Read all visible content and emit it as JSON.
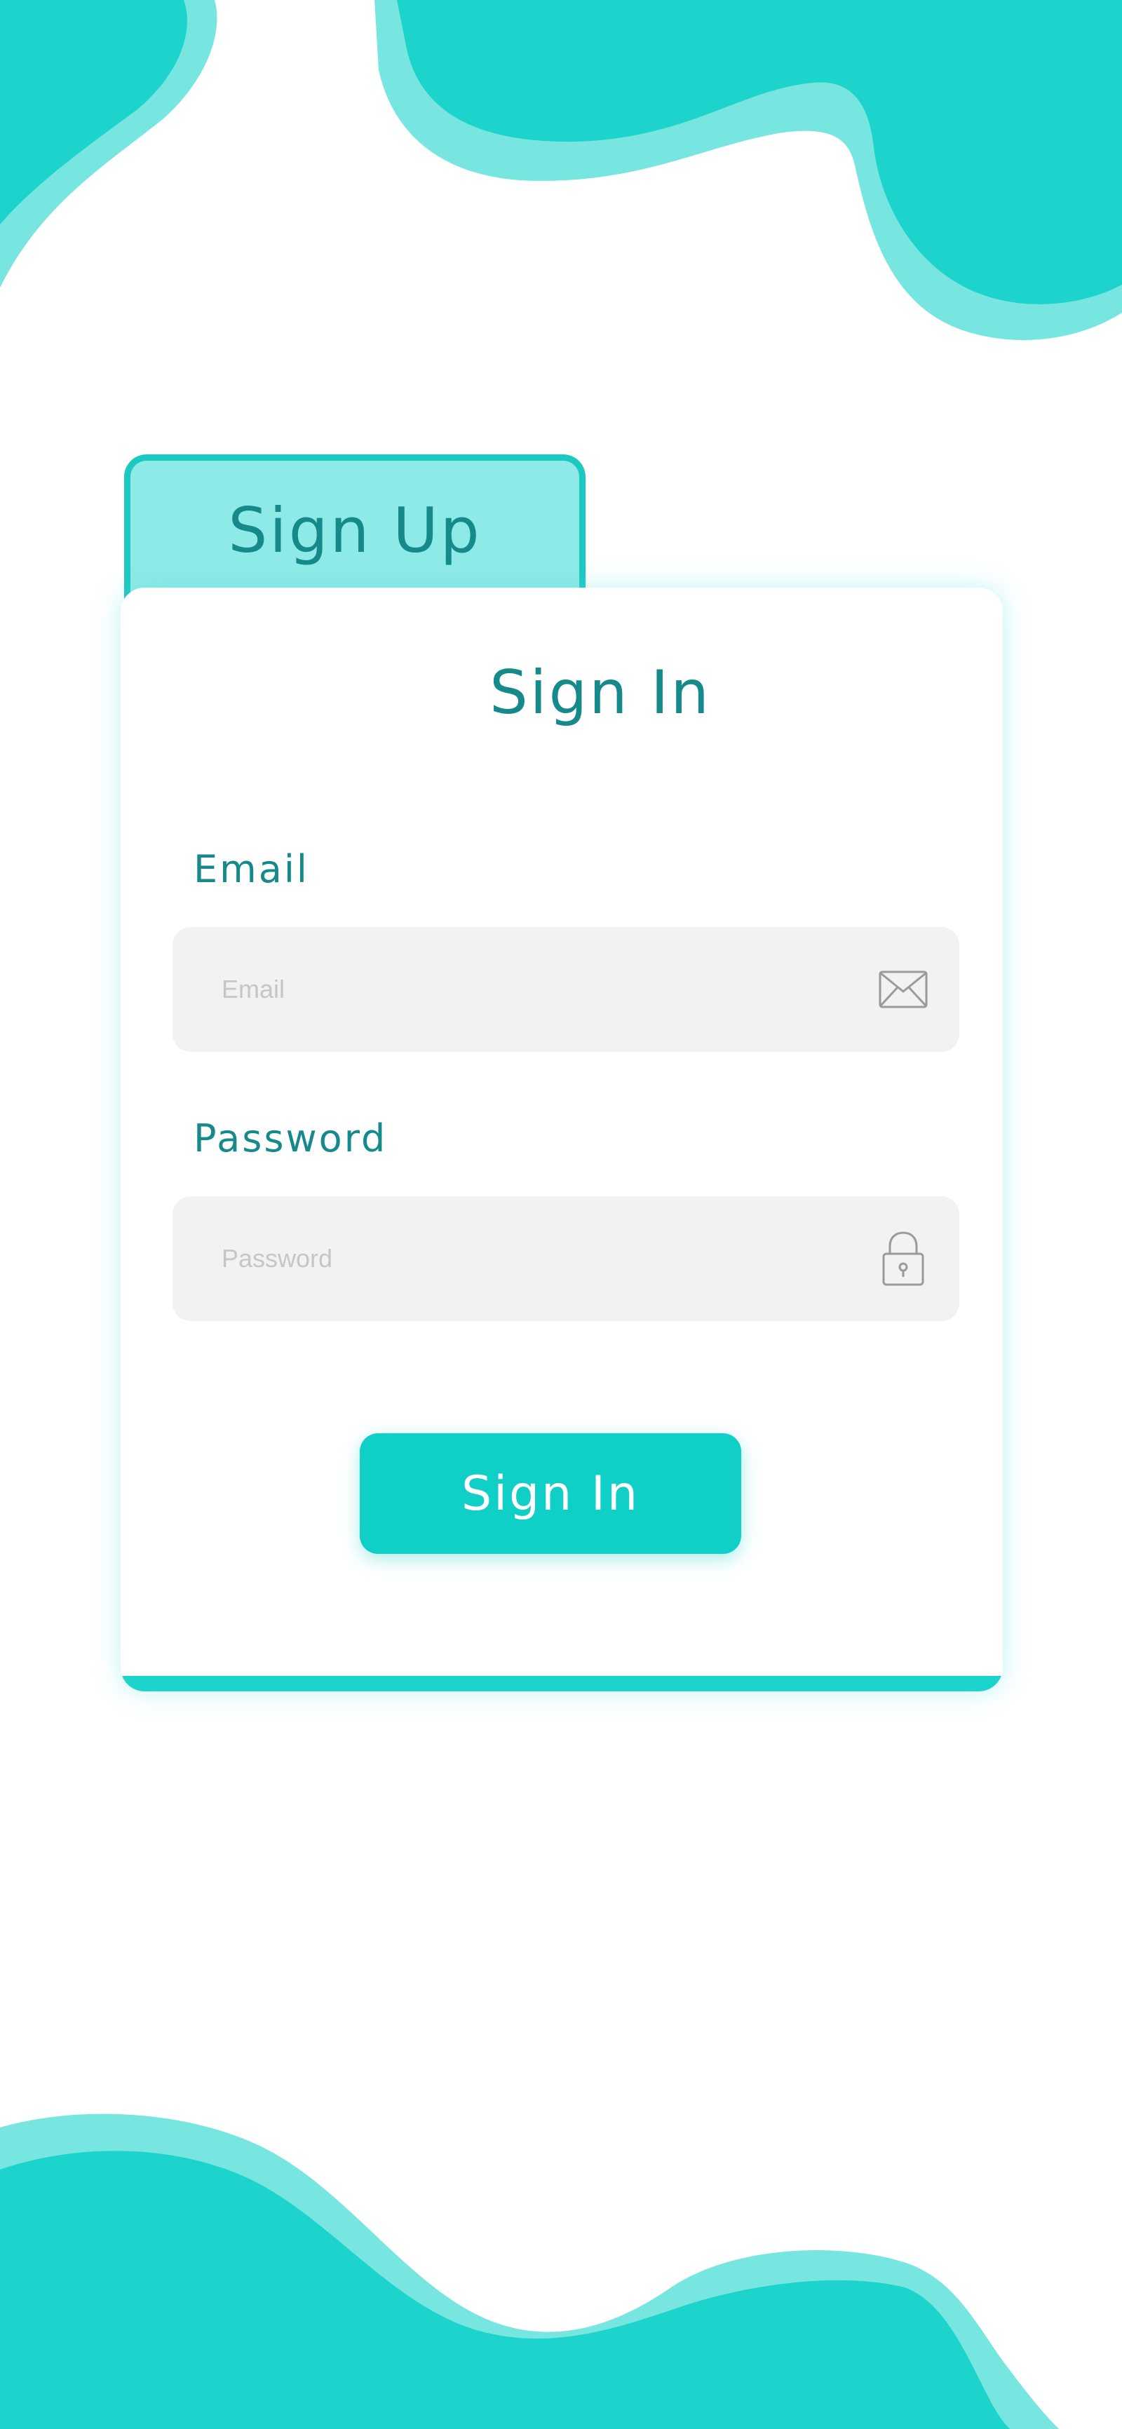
{
  "tabs": {
    "signup_label": "Sign Up"
  },
  "form": {
    "title": "Sign In",
    "email": {
      "label": "Email",
      "placeholder": "Email",
      "value": "",
      "icon": "mail-icon"
    },
    "password": {
      "label": "Password",
      "placeholder": "Password",
      "value": "",
      "icon": "lock-icon"
    },
    "submit_label": "Sign In"
  },
  "colors": {
    "accent": "#1cd4cc",
    "accent_light": "#78e6e0",
    "tab_background": "#8eeae6",
    "text_teal": "#168a8a",
    "button": "#0fcfc6",
    "input_background": "#f2f2f2"
  }
}
